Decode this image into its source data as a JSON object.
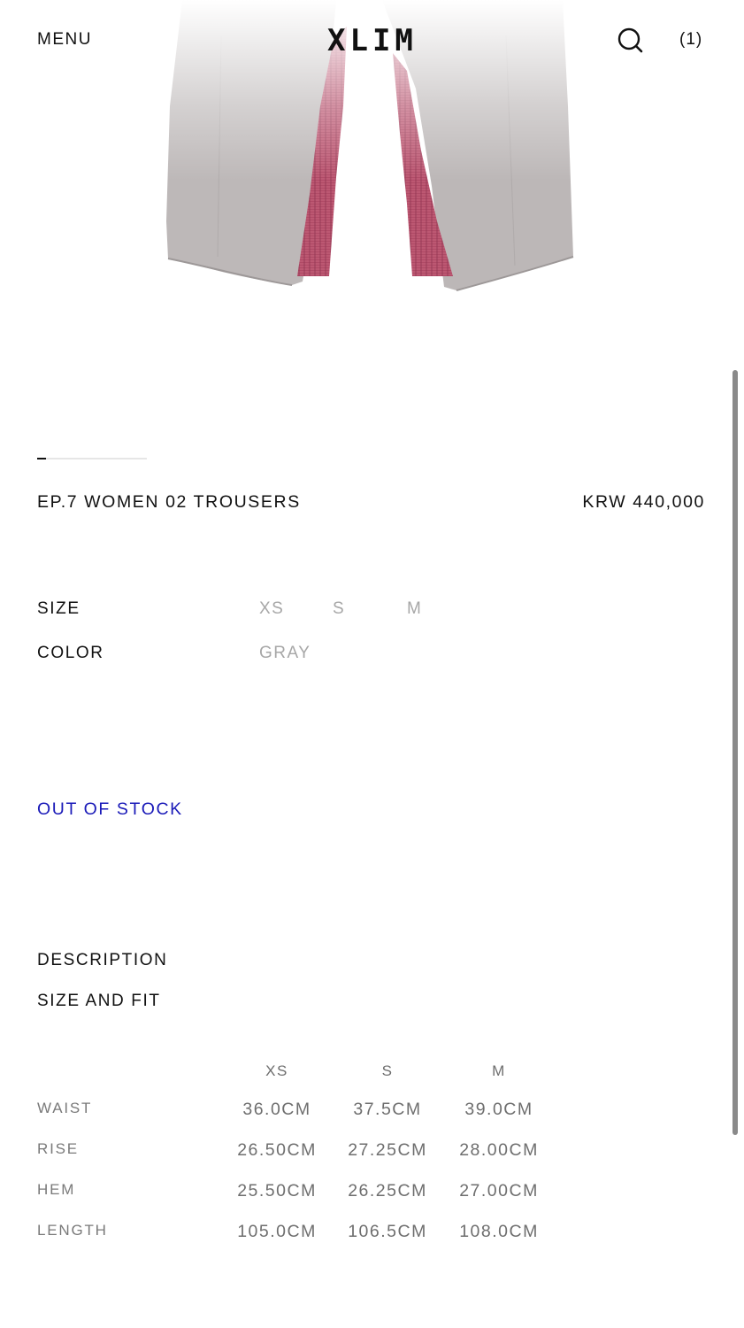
{
  "header": {
    "menu_label": "MENU",
    "logo": "XLIM",
    "search_icon": "search-icon",
    "cart_label": "(1)"
  },
  "product": {
    "image_icon": "trousers-photo",
    "name": "EP.7 WOMEN 02 TROUSERS",
    "price": "KRW 440,000",
    "size_label": "SIZE",
    "sizes": [
      "XS",
      "S",
      "M"
    ],
    "color_label": "COLOR",
    "colors": [
      "GRAY"
    ],
    "stock_status": "OUT OF STOCK",
    "stock_color": "#1a1ab8"
  },
  "sections": {
    "description": "DESCRIPTION",
    "size_and_fit": "SIZE AND FIT"
  },
  "size_table": {
    "columns": [
      "XS",
      "S",
      "M"
    ],
    "rows": [
      {
        "label": "WAIST",
        "values": [
          "36.0CM",
          "37.5CM",
          "39.0CM"
        ]
      },
      {
        "label": "RISE",
        "values": [
          "26.50CM",
          "27.25CM",
          "28.00CM"
        ]
      },
      {
        "label": "HEM",
        "values": [
          "25.50CM",
          "26.25CM",
          "27.00CM"
        ]
      },
      {
        "label": "LENGTH",
        "values": [
          "105.0CM",
          "106.5CM",
          "108.0CM"
        ]
      }
    ]
  }
}
